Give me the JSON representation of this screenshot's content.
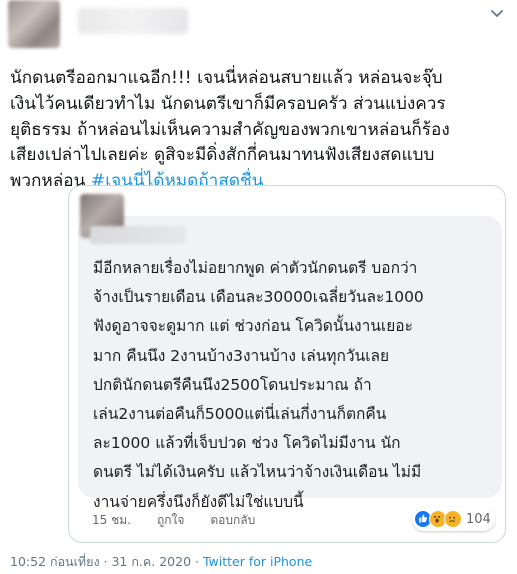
{
  "tweet": {
    "lines": [
      "นักดนตรีออกมาแฉอีก!!! เจนนี่หล่อนสบายแล้ว หล่อนจะจุ๊บ",
      "เงินไว้คนเดียวทำไม นักดนตรีเขาก็มีครอบครัว ส่วนแบ่งควร",
      "ยุติธรรม ถ้าหล่อนไม่เห็นความสำคัญของพวกเขาหล่อนก็ร้อง",
      "เสียงเปล่าไปเลยค่ะ ดูสิจะมีดิ่งสักกี่คนมาทนฟังเสียงสดแบบ"
    ],
    "last_line_prefix": "พวกหล่อน ",
    "hashtag": "#เจนนี่ได้หมดถ้าสดชื่น"
  },
  "embedded_comment": {
    "lines": [
      "มีอีกหลายเรื่องไม่อยากพูด ค่าตัวนักดนตรี บอกว่า",
      "จ้างเป็นรายเดือน เดือนละ30000เฉลี่ยวันละ1000",
      "ฟังดูอาจจะดูมาก แต่ ช่วงก่อน โควิดนั้นงานเยอะ",
      "มาก คืนนึง 2งานบ้าง3งานบ้าง เล่นทุกวันเลย",
      "ปกตินักดนตรีคืนนึง2500โดนประมาณ ถ้า",
      "เล่น2งานต่อคืนก็5000แต่นี่เล่นกี่งานก็ตกคืน",
      "ละ1000 แล้วที่เจ็บปวด ช่วง โควิดไม่มีงาน นัก",
      "ดนตรี ไม่ได้เงินครับ แล้วไหนว่าจ้างเงินเดือน ไม่มี",
      "งานจ่ายครึ่งนึงก็ยังดีไม่ใช่แบบนี้"
    ],
    "time": "15 ชม.",
    "like_label": "ถูกใจ",
    "reply_label": "ตอบกลับ",
    "reaction_count": "104",
    "reaction_icons": [
      "like-reaction-icon",
      "wow-reaction-icon",
      "sad-reaction-icon"
    ]
  },
  "footer": {
    "timestamp": "10:52 ก่อนเที่ยง · 31 ก.ค. 2020 · ",
    "source": "Twitter for iPhone"
  },
  "colors": {
    "text": "#14171a",
    "link": "#1b95e0",
    "muted": "#657786",
    "bubble": "#f0f2f5",
    "border": "#ccd6dd"
  }
}
